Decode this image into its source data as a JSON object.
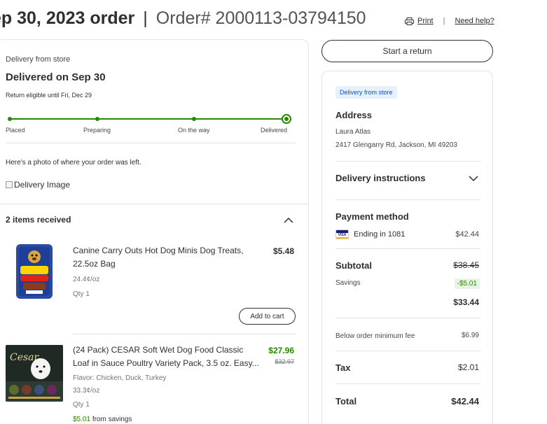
{
  "header": {
    "date": "ep 30, 2023 order",
    "separator": "|",
    "order_number": "Order# 2000113-03794150",
    "print_label": "Print",
    "help_label": "Need help?"
  },
  "delivery": {
    "from_label": "Delivery from store",
    "status_title": "Delivered on Sep 30",
    "return_eligible": "Return eligible until Fri, Dec 29",
    "tracker": {
      "steps": [
        "Placed",
        "Preparing",
        "On the way",
        "Delivered"
      ],
      "progress": 1.0
    },
    "photo_text": "Here's a photo of where your order was left.",
    "photo_alt": "Delivery Image"
  },
  "items": {
    "header": "2 items received",
    "list": [
      {
        "name_line1": "Canine Carry Outs Hot Dog Minis Dog Treats,",
        "name_line2": "22.5oz Bag",
        "unit_price": "24.4¢/oz",
        "qty": "Qty 1",
        "price": "$5.48",
        "add_to_cart": "Add to cart"
      },
      {
        "name_line1": "(24 Pack) CESAR Soft Wet Dog Food Classic",
        "name_line2": "Loaf in Sauce Poultry Variety Pack, 3.5 oz. Easy...",
        "flavor": "Flavor: Chicken, Duck, Turkey",
        "unit_price": "33.3¢/oz",
        "qty": "Qty 1",
        "price": "$27.96",
        "was_price": "$32.97",
        "savings_amount": "$5.01",
        "savings_text": "from savings"
      }
    ]
  },
  "actions": {
    "start_return": "Start a return"
  },
  "summary": {
    "badge": "Delivery from store",
    "address_title": "Address",
    "address_name": "Laura Atlas",
    "address_line": "2417 Glengarry Rd, Jackson, MI 49203",
    "instructions_title": "Delivery instructions",
    "payment_title": "Payment method",
    "card_brand": "VISA",
    "card_text": "Ending in 1081",
    "card_amount": "$42.44",
    "subtotal_label": "Subtotal",
    "subtotal_was": "$38.45",
    "savings_label": "Savings",
    "savings_value": "-$5.01",
    "subtotal_value": "$33.44",
    "fee_label": "Below order minimum fee",
    "fee_value": "$6.99",
    "tax_label": "Tax",
    "tax_value": "$2.01",
    "total_label": "Total",
    "total_value": "$42.44"
  },
  "colors": {
    "accent_green": "#2a8703",
    "link_blue": "#0053e2",
    "text": "#2e2f32"
  }
}
